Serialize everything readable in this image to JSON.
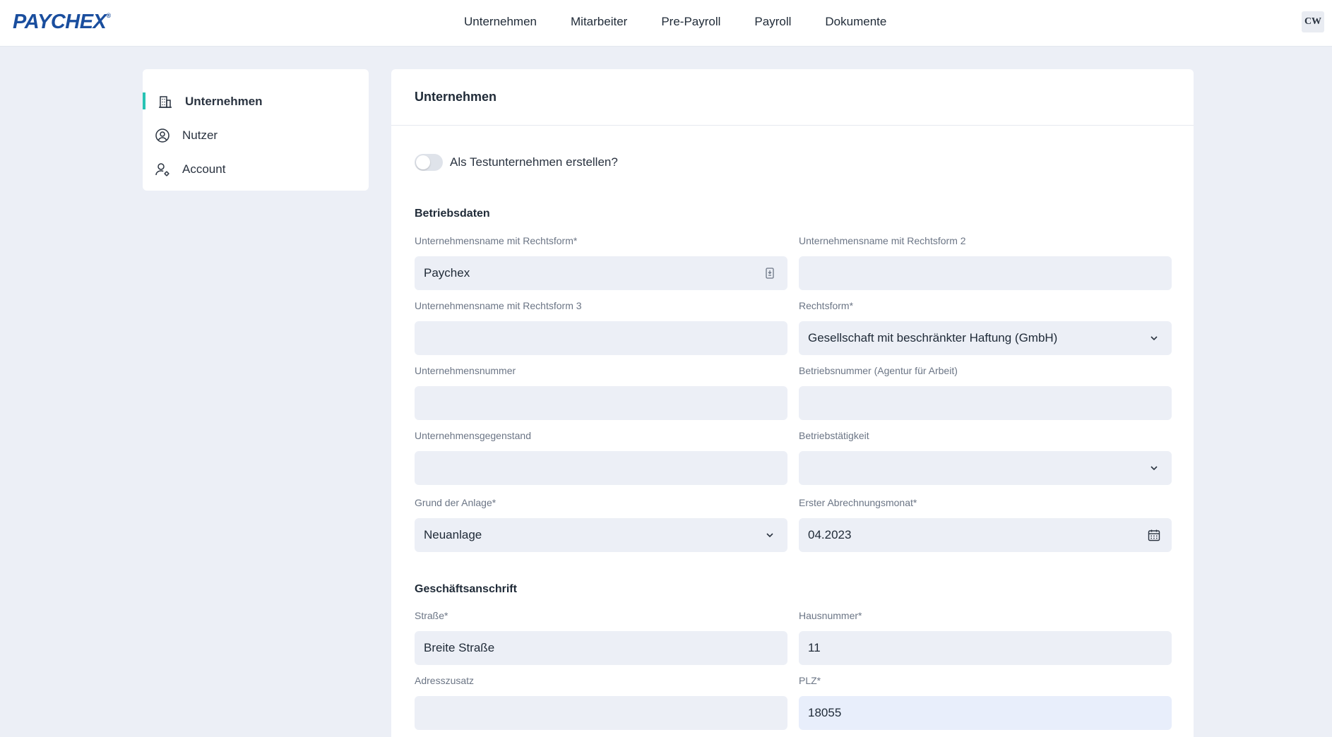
{
  "brand": {
    "logo_text": "PAYCHEX",
    "logo_mark": "®"
  },
  "nav": {
    "items": [
      {
        "label": "Unternehmen"
      },
      {
        "label": "Mitarbeiter"
      },
      {
        "label": "Pre-Payroll"
      },
      {
        "label": "Payroll"
      },
      {
        "label": "Dokumente"
      }
    ]
  },
  "user": {
    "initials": "CW"
  },
  "sidebar": {
    "items": [
      {
        "label": "Unternehmen",
        "icon": "building-icon",
        "active": true
      },
      {
        "label": "Nutzer",
        "icon": "user-circle-icon",
        "active": false
      },
      {
        "label": "Account",
        "icon": "user-gear-icon",
        "active": false
      }
    ]
  },
  "card": {
    "title": "Unternehmen",
    "test_toggle_label": "Als Testunternehmen erstellen?",
    "test_toggle_on": false
  },
  "betriebsdaten": {
    "title": "Betriebsdaten",
    "name1": {
      "label": "Unternehmensname mit Rechtsform*",
      "value": "Paychex"
    },
    "name2": {
      "label": "Unternehmensname mit Rechtsform 2",
      "value": ""
    },
    "name3": {
      "label": "Unternehmensname mit Rechtsform 3",
      "value": ""
    },
    "rechtsform": {
      "label": "Rechtsform*",
      "value": "Gesellschaft mit beschränkter Haftung (GmbH)"
    },
    "unternehmensnummer": {
      "label": "Unternehmensnummer",
      "value": ""
    },
    "betriebsnummer": {
      "label": "Betriebsnummer (Agentur für Arbeit)",
      "value": ""
    },
    "gegenstand": {
      "label": "Unternehmensgegenstand",
      "value": ""
    },
    "taetigkeit": {
      "label": "Betriebstätigkeit",
      "value": ""
    },
    "grund": {
      "label": "Grund der Anlage*",
      "value": "Neuanlage"
    },
    "abrechnungsmonat": {
      "label": "Erster Abrechnungsmonat*",
      "value": "04.2023"
    }
  },
  "anschrift": {
    "title": "Geschäftsanschrift",
    "strasse": {
      "label": "Straße*",
      "value": "Breite Straße"
    },
    "hausnummer": {
      "label": "Hausnummer*",
      "value": "11"
    },
    "adresszusatz": {
      "label": "Adresszusatz",
      "value": ""
    },
    "plz": {
      "label": "PLZ*",
      "value": "18055"
    }
  },
  "colors": {
    "brand_blue": "#1a4e9e",
    "accent_teal": "#27c3b4",
    "input_bg": "#eceff6",
    "page_bg": "#eceff6"
  }
}
